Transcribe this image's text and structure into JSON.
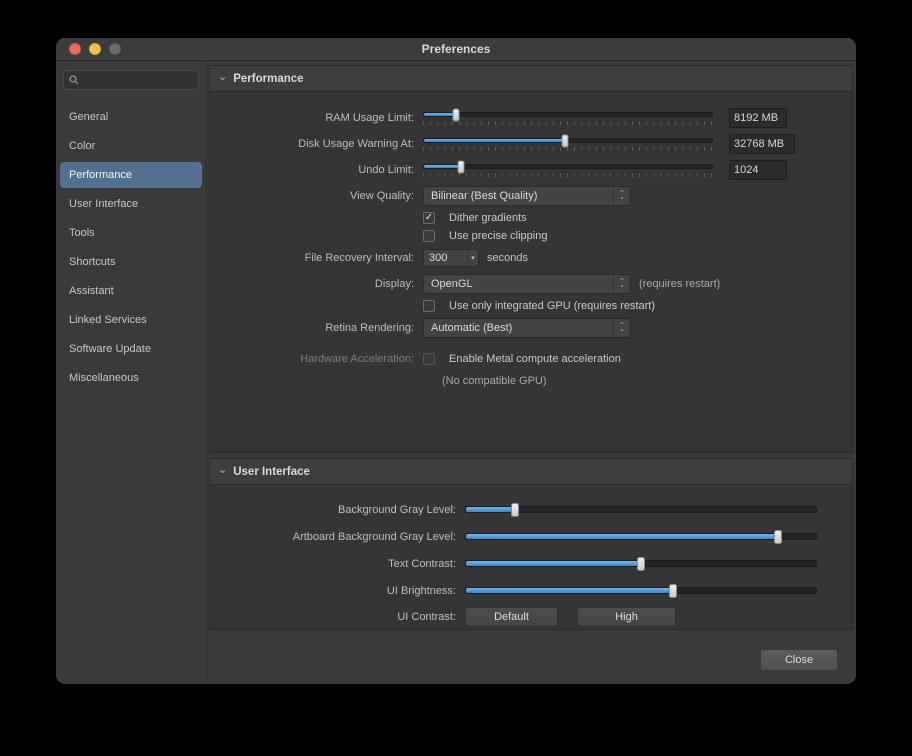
{
  "window": {
    "title": "Preferences",
    "close_label": "Close"
  },
  "sidebar": {
    "items": [
      {
        "label": "General"
      },
      {
        "label": "Color"
      },
      {
        "label": "Performance"
      },
      {
        "label": "User Interface"
      },
      {
        "label": "Tools"
      },
      {
        "label": "Shortcuts"
      },
      {
        "label": "Assistant"
      },
      {
        "label": "Linked Services"
      },
      {
        "label": "Software Update"
      },
      {
        "label": "Miscellaneous"
      }
    ],
    "selected": "Performance"
  },
  "performance": {
    "section_title": "Performance",
    "ram": {
      "label": "RAM Usage Limit:",
      "value": "8192 MB",
      "percent": 11
    },
    "disk": {
      "label": "Disk Usage Warning At:",
      "value": "32768 MB",
      "percent": 49
    },
    "undo": {
      "label": "Undo Limit:",
      "value": "1024",
      "percent": 13
    },
    "view_quality": {
      "label": "View Quality:",
      "value": "Bilinear (Best Quality)"
    },
    "dither": {
      "label": "Dither gradients",
      "checked": true
    },
    "precise_clipping": {
      "label": "Use precise clipping",
      "checked": false
    },
    "file_recovery": {
      "label": "File Recovery Interval:",
      "value": "300",
      "suffix": "seconds"
    },
    "display": {
      "label": "Display:",
      "value": "OpenGL",
      "note": "(requires restart)"
    },
    "integrated_gpu": {
      "label": "Use only integrated GPU (requires restart)",
      "checked": false
    },
    "retina": {
      "label": "Retina Rendering:",
      "value": "Automatic (Best)"
    },
    "hardware_accel": {
      "label": "Hardware Acceleration:",
      "checkbox_label": "Enable Metal compute acceleration",
      "checked": false,
      "note": "(No compatible GPU)"
    }
  },
  "user_interface": {
    "section_title": "User Interface",
    "sliders": [
      {
        "label": "Background Gray Level:",
        "percent": 14
      },
      {
        "label": "Artboard Background Gray Level:",
        "percent": 89
      },
      {
        "label": "Text Contrast:",
        "percent": 50
      },
      {
        "label": "UI Brightness:",
        "percent": 59
      }
    ],
    "ui_contrast": {
      "label": "UI Contrast:",
      "default_label": "Default",
      "high_label": "High"
    }
  }
}
